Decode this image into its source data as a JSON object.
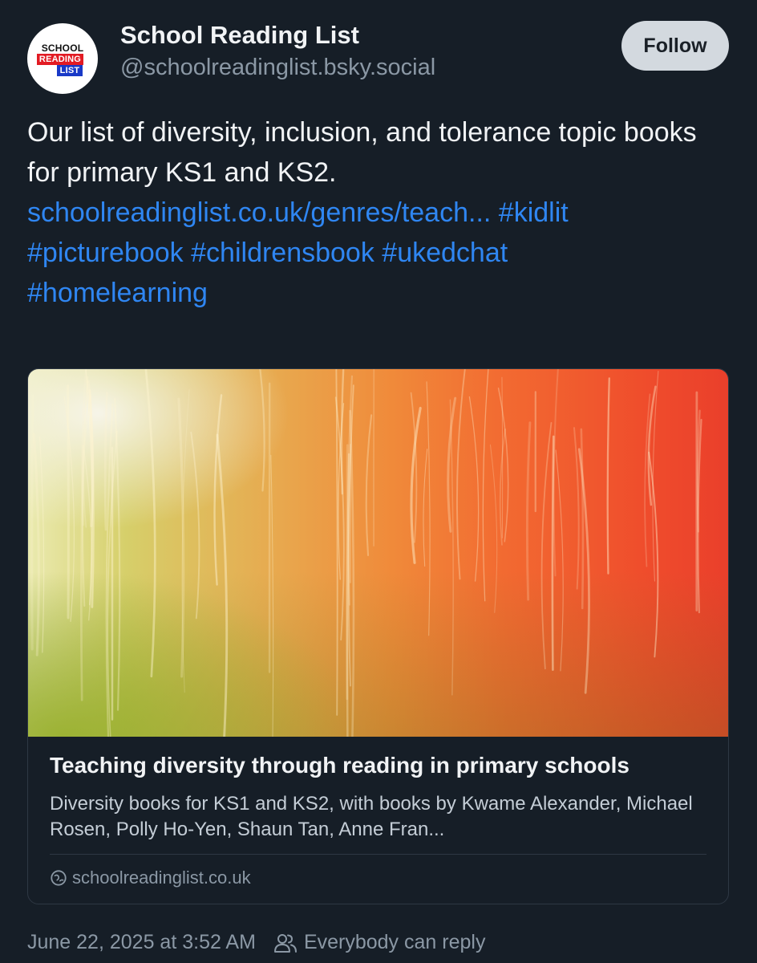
{
  "author": {
    "display_name": "School Reading List",
    "handle": "@schoolreadinglist.bsky.social",
    "avatar_logo": [
      "SCHOOL",
      "READING",
      "LIST"
    ]
  },
  "follow_label": "Follow",
  "post": {
    "text": "Our list of diversity, inclusion, and tolerance topic books for primary KS1 and KS2.",
    "link": "schoolreadinglist.co.uk/genres/teach...",
    "hashtags": [
      "#kidlit",
      "#picturebook",
      "#childrensbook",
      "#ukedchat",
      "#homelearning"
    ]
  },
  "link_card": {
    "title": "Teaching diversity through reading in primary schools",
    "description": "Diversity books for KS1 and KS2, with books by Kwame Alexander, Michael Rosen, Polly Ho-Yen, Shaun Tan, Anne Fran...",
    "domain": "schoolreadinglist.co.uk",
    "domain_icon": "globe-icon",
    "image_colors": [
      "#eaeab0",
      "#d6cf6a",
      "#f08a3a",
      "#ea3f2b"
    ]
  },
  "footer": {
    "timestamp": "June 22, 2025 at 3:52 AM",
    "reply_setting": "Everybody can reply",
    "reply_icon": "people-icon"
  },
  "colors": {
    "background": "#161e27",
    "link": "#2f86f2",
    "muted": "#8b98a5",
    "follow_bg": "#d3d9df"
  }
}
